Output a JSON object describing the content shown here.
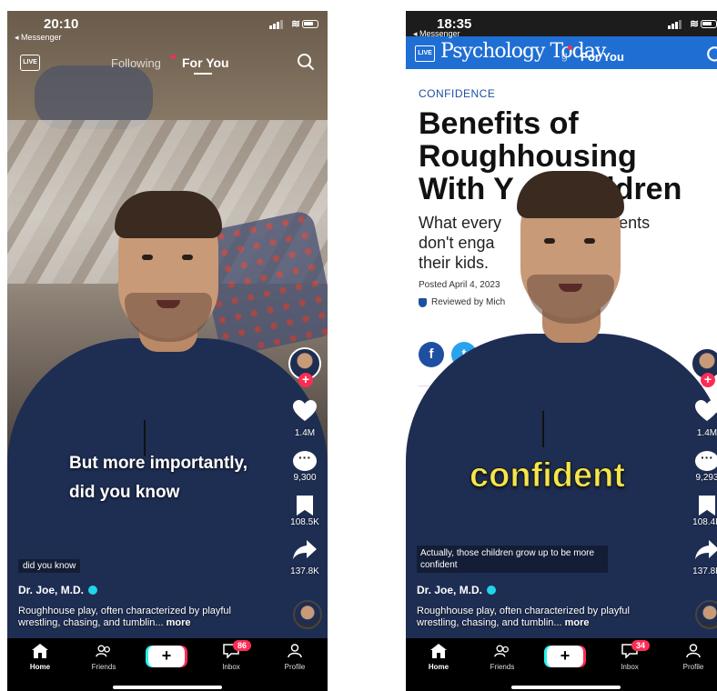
{
  "left": {
    "status": {
      "time": "20:10",
      "back_label": "◂ Messenger"
    },
    "nav": {
      "live": "LIVE",
      "following": "Following",
      "for_you": "For You"
    },
    "rail": {
      "likes": "1.4M",
      "comments": "9,300",
      "saves": "108.5K",
      "shares": "137.8K"
    },
    "caption": {
      "line1": "But more importantly,",
      "line2": "did you know"
    },
    "sticker": "did you know",
    "author": "Dr. Joe, M.D.",
    "description": "Roughhouse play, often characterized by playful wrestling, chasing, and tumblin...",
    "more": "more",
    "bottombar": {
      "home": "Home",
      "friends": "Friends",
      "inbox": "Inbox",
      "profile": "Profile",
      "inbox_badge": "86"
    }
  },
  "right": {
    "status": {
      "time": "18:35",
      "back_label": "◂ Messenger"
    },
    "article": {
      "site": "Psychology Today",
      "logo_icon": "LIVE",
      "tab_fragment": "g",
      "for_you": "For You",
      "kicker": "CONFIDENCE",
      "headline_1": "Benefits of",
      "headline_2": "Roughhousing",
      "headline_3": "With Y     Children",
      "subhead_1": "What every           when parents",
      "subhead_2": "don't enga          l play with",
      "subhead_3": "their kids.",
      "posted": "Posted April 4, 2023",
      "reviewed": "Reviewed by Mich",
      "share_f": "f",
      "share_t": "t"
    },
    "rail": {
      "likes": "1.4M",
      "comments": "9,293",
      "saves": "108.4K",
      "shares": "137.8K"
    },
    "caption": "confident",
    "sticker": "Actually, those children grow up to be more confident",
    "author": "Dr. Joe, M.D.",
    "description": "Roughhouse play, often characterized by playful wrestling, chasing, and tumblin...",
    "more": "more",
    "bottombar": {
      "home": "Home",
      "friends": "Friends",
      "inbox": "Inbox",
      "profile": "Profile",
      "inbox_badge": "34"
    }
  },
  "colors": {
    "tiktok_red": "#fe2c55",
    "tiktok_cyan": "#25f4ee",
    "pt_blue": "#1f6ed4",
    "caption_yellow": "#f4e64c",
    "scrubs_navy": "#1e2d52"
  },
  "icons": [
    "live-icon",
    "search-icon",
    "plus-icon",
    "heart-icon",
    "comment-icon",
    "bookmark-icon",
    "share-icon",
    "home-icon",
    "friends-icon",
    "inbox-icon",
    "profile-icon",
    "verified-icon",
    "shield-icon",
    "facebook-icon",
    "twitter-icon"
  ]
}
